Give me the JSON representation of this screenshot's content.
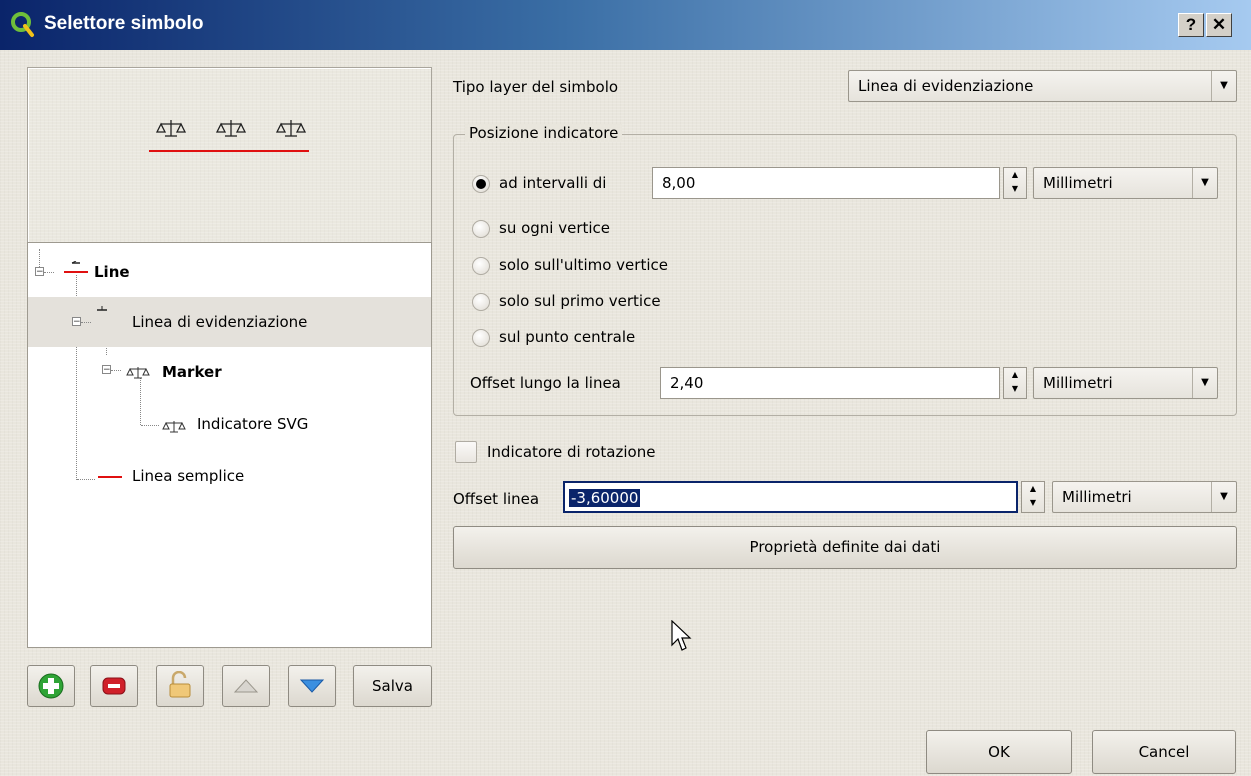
{
  "window": {
    "title": "Selettore simbolo",
    "help_label": "?",
    "close_label": "✕"
  },
  "tree": {
    "items": [
      {
        "label": "Line"
      },
      {
        "label": "Linea di evidenziazione"
      },
      {
        "label": "Marker"
      },
      {
        "label": "Indicatore SVG"
      },
      {
        "label": "Linea semplice"
      }
    ]
  },
  "toolbar": {
    "save_label": "Salva"
  },
  "form": {
    "layer_type_label": "Tipo layer del simbolo",
    "layer_type_value": "Linea di evidenziazione",
    "position_group_title": "Posizione indicatore",
    "interval_label": "ad intervalli di",
    "interval_value": "8,00",
    "interval_unit": "Millimetri",
    "radio_every_vertex": "su ogni vertice",
    "radio_last_vertex": "solo sull'ultimo vertice",
    "radio_first_vertex": "solo sul primo vertice",
    "radio_center": "sul punto centrale",
    "offset_along_label": "Offset lungo la linea",
    "offset_along_value": "2,40",
    "offset_along_unit": "Millimetri",
    "rotate_label": "Indicatore di rotazione",
    "rotate_checked": false,
    "line_offset_label": "Offset linea",
    "line_offset_value": "-3,60000",
    "line_offset_unit": "Millimetri",
    "data_defined_button": "Proprietà definite dai dati"
  },
  "footer": {
    "ok_label": "OK",
    "cancel_label": "Cancel"
  },
  "colors": {
    "accent_line": "#e01010",
    "selection": "#0a246a"
  }
}
